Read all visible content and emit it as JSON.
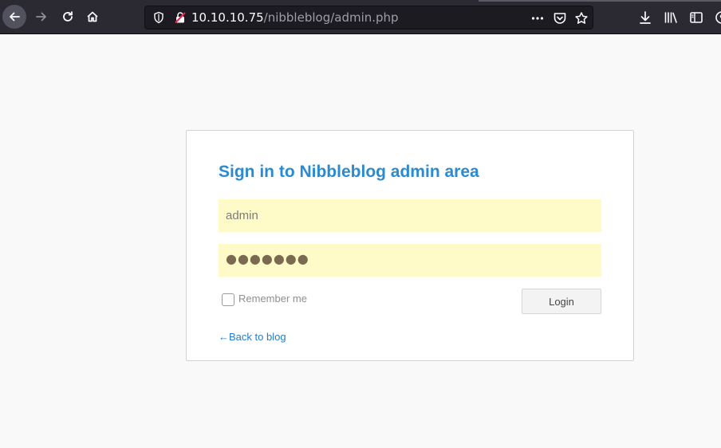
{
  "browser": {
    "url_host": "10.10.10.75",
    "url_path": "/nibbleblog/admin.php",
    "icons": {
      "back": "back-arrow-icon",
      "forward": "forward-arrow-icon",
      "reload": "reload-icon",
      "home": "home-icon",
      "shield": "tracking-shield-icon",
      "insecure": "insecure-lock-icon",
      "more": "page-actions-icon",
      "pocket": "pocket-icon",
      "bookmark": "star-icon",
      "downloads": "download-icon",
      "library": "library-icon",
      "sidebar": "sidebar-icon",
      "account": "account-icon"
    }
  },
  "login": {
    "title": "Sign in to Nibbleblog admin area",
    "username_value": "admin",
    "password_masked": "●●●●●●●",
    "remember_label": "Remember me",
    "login_label": "Login",
    "back_link": "←Back to blog"
  },
  "colors": {
    "title": "#2a8ad2",
    "field_bg": "#fffbc8",
    "link": "#2a7cc4",
    "toolbar": "#2b2a33"
  }
}
